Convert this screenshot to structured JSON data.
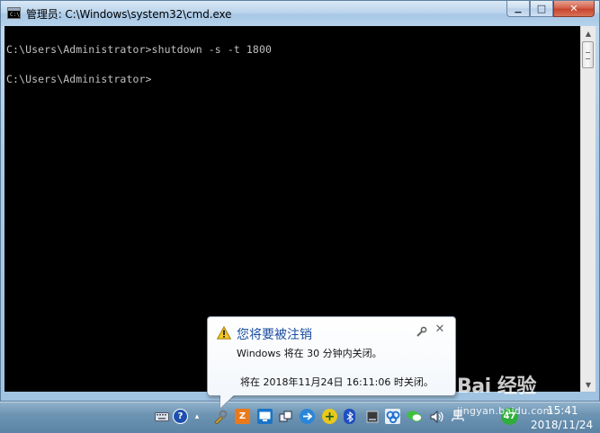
{
  "window": {
    "title": "管理员: C:\\Windows\\system32\\cmd.exe",
    "icon": "cmd-icon",
    "buttons": {
      "minimize": "▁",
      "maximize": "□",
      "close": "✕"
    }
  },
  "console": {
    "lines": [
      "C:\\Users\\Administrator>shutdown -s -t 1800",
      "C:\\Users\\Administrator>"
    ],
    "background": "#000000",
    "foreground": "#c0c0c0"
  },
  "balloon": {
    "title": "您将要被注销",
    "message": "Windows 将在 30 分钟内关闭。",
    "detail": "将在 2018年11月24日 16:11:06 时关闭。",
    "icon": "warning-icon",
    "title_color": "#1b4da0"
  },
  "taskbar": {
    "tray_icons": [
      "keyboard-icon",
      "help-icon",
      "show-hidden-icon",
      "tool-icon",
      "app-icon",
      "monitor-icon",
      "network-icon",
      "browser-icon",
      "plus-icon",
      "bluetooth-icon",
      "device-icon",
      "qq-icon",
      "wechat-icon",
      "volume-icon",
      "lan-icon",
      "speed-icon"
    ],
    "speed_badge": "47",
    "clock": {
      "time": "15:41",
      "date": "2018/11/24"
    }
  },
  "watermark": {
    "logo": "Bai 经验",
    "url": "jingyan.baidu.com"
  }
}
